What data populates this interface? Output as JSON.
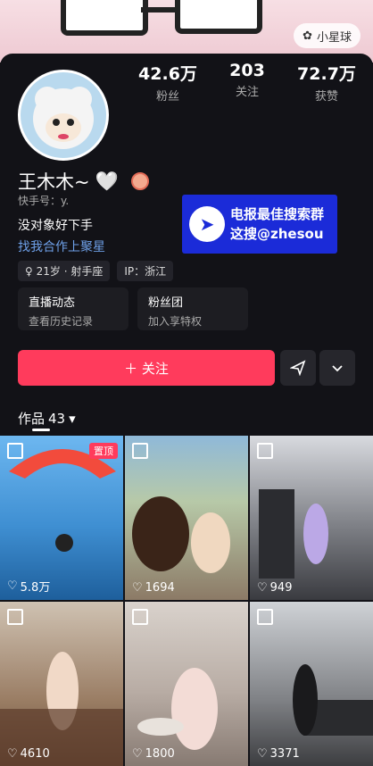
{
  "header": {
    "planet_label": "小星球"
  },
  "stats": [
    {
      "value": "42.6万",
      "label": "粉丝"
    },
    {
      "value": "203",
      "label": "关注"
    },
    {
      "value": "72.7万",
      "label": "获赞"
    }
  ],
  "profile": {
    "name": "王木木~",
    "kuaishou_id": "快手号：y.",
    "bio_line1": "没对象好下手",
    "bio_line2": "找我合作上聚星",
    "tags": [
      "21岁 · 射手座",
      "IP：浙江"
    ]
  },
  "ad": {
    "line1": "电报最佳搜索群",
    "line2": "这搜@zhesou"
  },
  "entries": [
    {
      "title": "直播动态",
      "subtitle": "查看历史记录"
    },
    {
      "title": "粉丝团",
      "subtitle": "加入享特权"
    }
  ],
  "actions": {
    "follow_label": "＋ 关注"
  },
  "works": {
    "tab_label": "作品",
    "count": "43"
  },
  "grid": [
    {
      "likes": "5.8万",
      "pinned": "置顶"
    },
    {
      "likes": "1694"
    },
    {
      "likes": "949"
    },
    {
      "likes": "4610"
    },
    {
      "likes": "1800"
    },
    {
      "likes": "3371"
    }
  ]
}
